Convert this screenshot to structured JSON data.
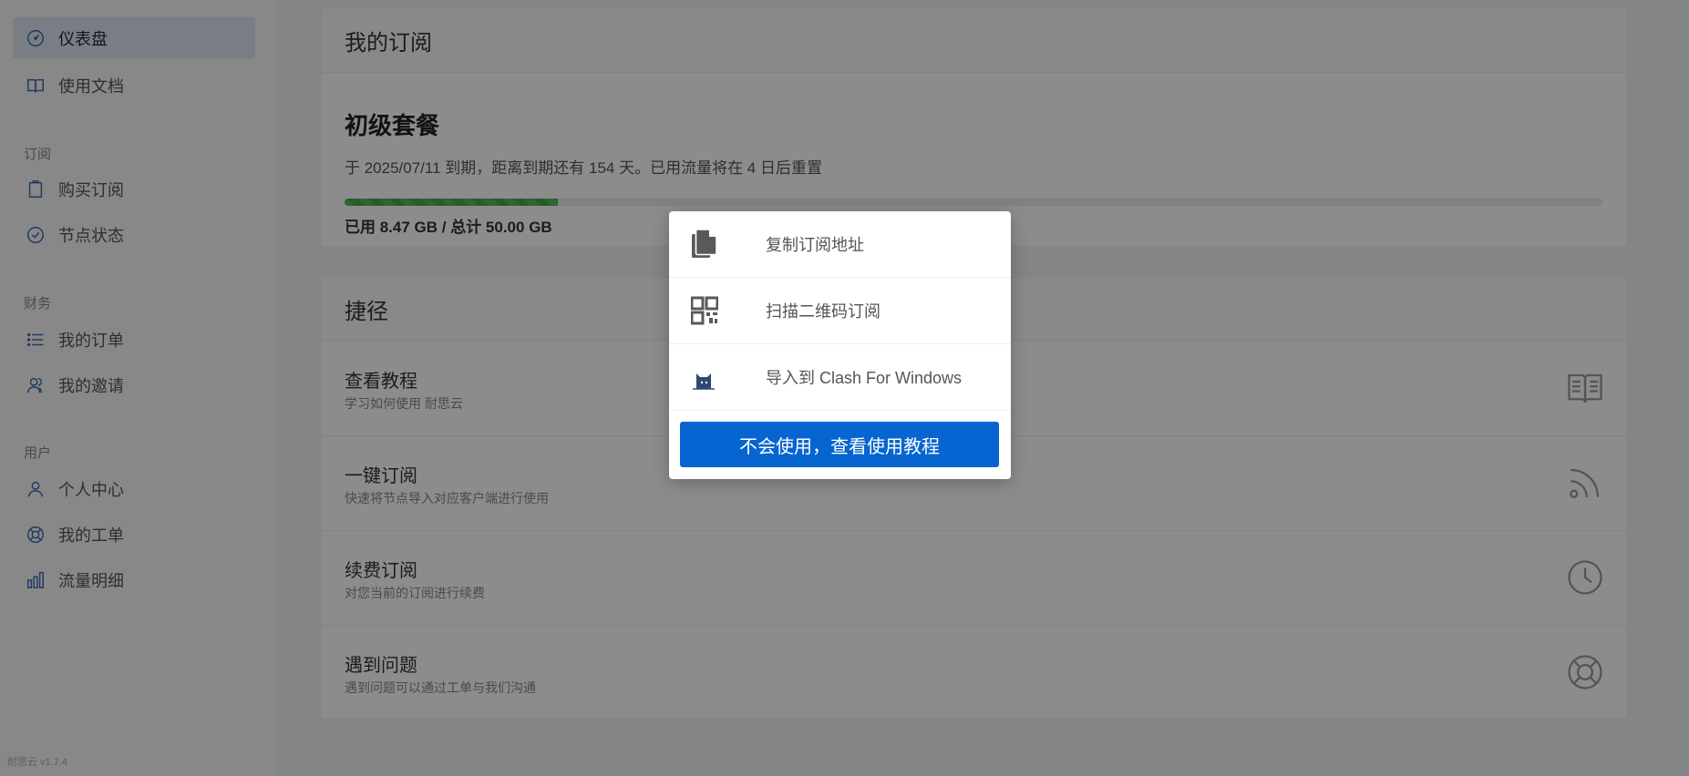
{
  "sidebar": {
    "items": [
      {
        "label": "仪表盘",
        "icon": "dashboard-icon"
      },
      {
        "label": "使用文档",
        "icon": "book-icon"
      },
      {
        "label": "购买订阅",
        "icon": "clipboard-icon"
      },
      {
        "label": "节点状态",
        "icon": "check-circle-icon"
      },
      {
        "label": "我的订单",
        "icon": "list-icon"
      },
      {
        "label": "我的邀请",
        "icon": "users-icon"
      },
      {
        "label": "个人中心",
        "icon": "user-icon"
      },
      {
        "label": "我的工单",
        "icon": "support-icon"
      },
      {
        "label": "流量明细",
        "icon": "bar-chart-icon"
      }
    ],
    "groups": [
      "订阅",
      "财务",
      "用户"
    ],
    "version": "耐思云 v1.7.4"
  },
  "subscription": {
    "header": "我的订阅",
    "plan_name": "初级套餐",
    "description": "于 2025/07/11 到期，距离到期还有 154 天。已用流量将在 4 日后重置",
    "usage": "已用 8.47 GB / 总计 50.00 GB",
    "used_gb": 8.47,
    "total_gb": 50.0
  },
  "shortcuts": {
    "header": "捷径",
    "items": [
      {
        "title": "查看教程",
        "subtitle": "学习如何使用 耐思云",
        "icon": "book-icon"
      },
      {
        "title": "一键订阅",
        "subtitle": "快速将节点导入对应客户端进行使用",
        "icon": "rss-icon"
      },
      {
        "title": "续费订阅",
        "subtitle": "对您当前的订阅进行续费",
        "icon": "clock-icon"
      },
      {
        "title": "遇到问题",
        "subtitle": "遇到问题可以通过工单与我们沟通",
        "icon": "lifebuoy-icon"
      }
    ]
  },
  "popup": {
    "items": [
      {
        "label": "复制订阅地址",
        "icon": "copy-icon"
      },
      {
        "label": "扫描二维码订阅",
        "icon": "qrcode-icon"
      },
      {
        "label": "导入到 Clash For Windows",
        "icon": "clash-cat-icon"
      }
    ],
    "button": "不会使用，查看使用教程"
  },
  "colors": {
    "primary": "#0665d0",
    "progress": "#5cb85c"
  }
}
